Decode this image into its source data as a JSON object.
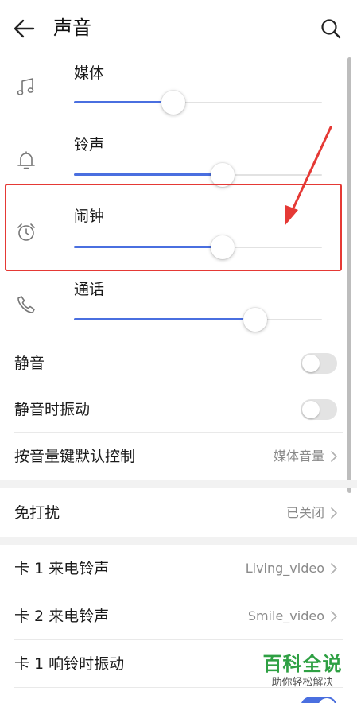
{
  "header": {
    "title": "声音",
    "back_icon": "arrow-left-icon",
    "search_icon": "search-icon"
  },
  "volumes": [
    {
      "label": "媒体",
      "icon": "music-note-icon",
      "level": 0.4
    },
    {
      "label": "铃声",
      "icon": "bell-icon",
      "level": 0.6
    },
    {
      "label": "闹钟",
      "icon": "alarm-clock-icon",
      "level": 0.6,
      "highlighted": true
    },
    {
      "label": "通话",
      "icon": "phone-icon",
      "level": 0.73
    }
  ],
  "toggles": {
    "mute": {
      "label": "静音",
      "on": false
    },
    "vibrate_on_mute": {
      "label": "静音时振动",
      "on": false
    }
  },
  "volume_key": {
    "label": "按音量键默认控制",
    "value": "媒体音量"
  },
  "dnd": {
    "label": "免打扰",
    "value": "已关闭"
  },
  "ringtones": {
    "sim1": {
      "label": "卡 1 来电铃声",
      "value": "Living_video"
    },
    "sim2": {
      "label": "卡 2 来电铃声",
      "value": "Smile_video"
    },
    "sim1_vibrate": {
      "label": "卡 1 响铃时振动"
    }
  },
  "watermark": {
    "title": "百科全说",
    "subtitle": "助你轻松解决"
  },
  "colors": {
    "accent": "#4a6fe0",
    "highlight": "#e53935",
    "watermark": "#2ea043"
  }
}
